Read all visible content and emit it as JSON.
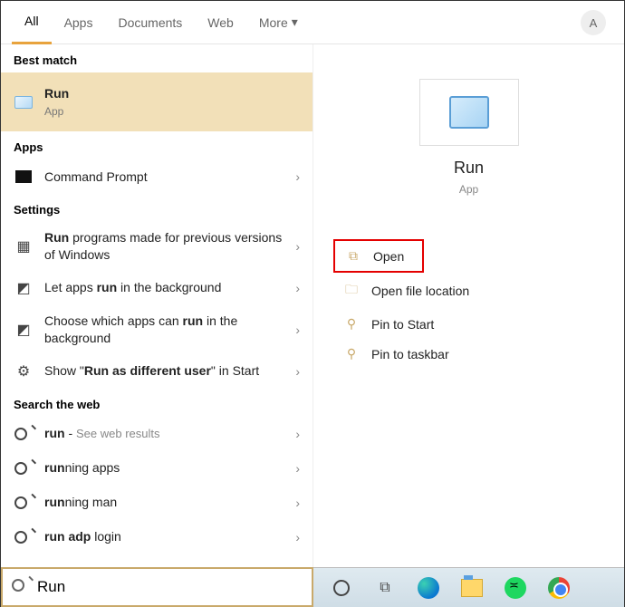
{
  "tabs": {
    "all": "All",
    "apps": "Apps",
    "documents": "Documents",
    "web": "Web",
    "more": "More"
  },
  "avatar": "A",
  "sections": {
    "best": "Best match",
    "apps": "Apps",
    "settings": "Settings",
    "web": "Search the web"
  },
  "best_match": {
    "title": "Run",
    "sub": "App"
  },
  "apps_list": {
    "cmd": "Command Prompt"
  },
  "settings_list": {
    "s1_pre": "Run",
    "s1_post": " programs made for previous versions of Windows",
    "s2_pre": "Let apps ",
    "s2_b": "run",
    "s2_post": " in the background",
    "s3_pre": "Choose which apps can ",
    "s3_b": "run",
    "s3_post": " in the background",
    "s4_pre": "Show \"",
    "s4_b": "Run as different user",
    "s4_post": "\" in Start"
  },
  "web_list": {
    "w1_b": "run",
    "w1_post": " - ",
    "w1_faded": "See web results",
    "w2_b": "run",
    "w2_post": "ning apps",
    "w3_b": "run",
    "w3_post": "ning man",
    "w4_b": "run adp",
    "w4_post": " login"
  },
  "preview": {
    "title": "Run",
    "sub": "App"
  },
  "actions": {
    "open": "Open",
    "loc": "Open file location",
    "pin_start": "Pin to Start",
    "pin_tb": "Pin to taskbar"
  },
  "search_value": "Run"
}
